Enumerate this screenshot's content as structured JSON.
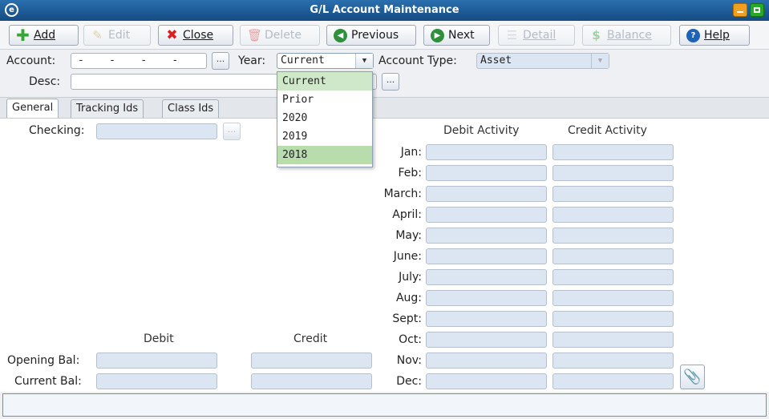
{
  "window": {
    "title": "G/L Account Maintenance",
    "app_icon": "e"
  },
  "toolbar": {
    "add": "Add",
    "edit": "Edit",
    "close": "Close",
    "delete": "Delete",
    "previous": "Previous",
    "next": "Next",
    "detail": "Detail",
    "balance": "Balance",
    "help": "Help"
  },
  "form": {
    "account_label": "Account:",
    "account_value": "-    -    -    -",
    "year_label": "Year:",
    "year_value": "Current",
    "account_type_label": "Account Type:",
    "account_type_value": "Asset",
    "desc_label": "Desc:",
    "desc_value": "",
    "dots": "..."
  },
  "year_dropdown": {
    "options": [
      "Current",
      "Prior",
      "2020",
      "2019",
      "2018"
    ],
    "selected": "Current",
    "hovered": "2018"
  },
  "tabs": [
    "General",
    "Tracking Ids",
    "Class Ids"
  ],
  "general": {
    "checking_label": "Checking:",
    "debit_activity_label": "Debit Activity",
    "credit_activity_label": "Credit Activity",
    "months": [
      "Jan:",
      "Feb:",
      "March:",
      "April:",
      "May:",
      "June:",
      "July:",
      "Aug:",
      "Sept:",
      "Oct:",
      "Nov:",
      "Dec:"
    ],
    "debit_label": "Debit",
    "credit_label": "Credit",
    "opening_bal_label": "Opening Bal:",
    "current_bal_label": "Current Bal:"
  },
  "colors": {
    "titlebar": "#154b82",
    "readonly_field": "#dce6f3",
    "dropdown_highlight": "#b8dcae"
  }
}
